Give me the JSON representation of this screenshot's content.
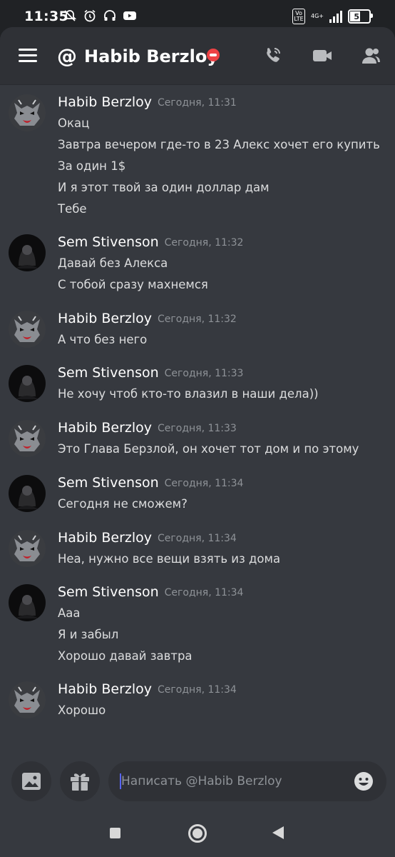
{
  "status_bar": {
    "time": "11:35",
    "volte": "Vo LTE",
    "network": "4G+",
    "battery": "51",
    "battery_level": 0.51
  },
  "header": {
    "at_symbol": "@",
    "title": "Habib Berzloy",
    "status": "do-not-disturb",
    "status_color": "#ed4245",
    "actions": [
      "phone-icon",
      "video-camera-icon",
      "members-icon"
    ]
  },
  "messages": [
    {
      "author": "Habib Berzloy",
      "timestamp": "Сегодня, 11:31",
      "avatar": "wolf-avatar",
      "lines": [
        "Окац",
        "Завтра вечером где-то в 23 Алекс хочет его купить",
        "За один 1$",
        "И я этот твой за один доллар дам",
        "Тебе"
      ]
    },
    {
      "author": "Sem Stivenson",
      "timestamp": "Сегодня, 11:32",
      "avatar": "dark-avatar",
      "lines": [
        "Давай без Алекса",
        "С тобой сразу махнемся"
      ]
    },
    {
      "author": "Habib Berzloy",
      "timestamp": "Сегодня, 11:32",
      "avatar": "wolf-avatar",
      "lines": [
        "А что без него"
      ]
    },
    {
      "author": "Sem Stivenson",
      "timestamp": "Сегодня, 11:33",
      "avatar": "dark-avatar",
      "lines": [
        "Не хочу чтоб кто-то влазил в наши дела))"
      ]
    },
    {
      "author": "Habib Berzloy",
      "timestamp": "Сегодня, 11:33",
      "avatar": "wolf-avatar",
      "lines": [
        "Это Глава Берзлой, он хочет тот дом и по этому"
      ]
    },
    {
      "author": "Sem Stivenson",
      "timestamp": "Сегодня, 11:34",
      "avatar": "dark-avatar",
      "lines": [
        "Сегодня не сможем?"
      ]
    },
    {
      "author": "Habib Berzloy",
      "timestamp": "Сегодня, 11:34",
      "avatar": "wolf-avatar",
      "lines": [
        "Неа, нужно все вещи взять из дома"
      ]
    },
    {
      "author": "Sem Stivenson",
      "timestamp": "Сегодня, 11:34",
      "avatar": "dark-avatar",
      "lines": [
        "Ааа",
        "Я и забыл",
        "Хорошо давай завтра"
      ]
    },
    {
      "author": "Habib Berzloy",
      "timestamp": "Сегодня, 11:34",
      "avatar": "wolf-avatar",
      "lines": [
        "Хорошо"
      ]
    }
  ],
  "composer": {
    "placeholder": "Написать @Habib Berzloy",
    "left_buttons": [
      "image-icon",
      "gift-icon"
    ],
    "emoji_button": "emoji-icon"
  },
  "navbar": [
    "recents-button",
    "home-button",
    "back-button"
  ]
}
